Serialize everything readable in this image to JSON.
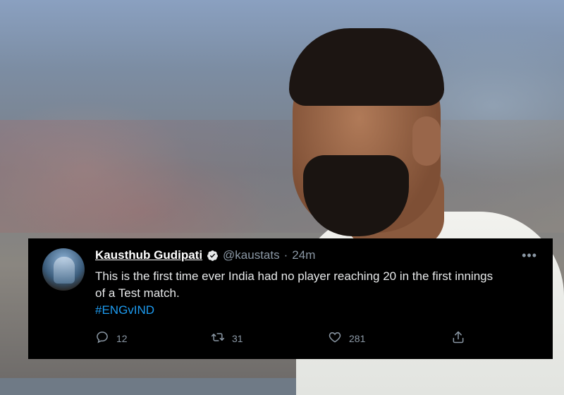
{
  "tweet": {
    "author_name": "Kausthub Gudipati",
    "handle": "@kaustats",
    "separator": "·",
    "time": "24m",
    "more_label": "•••",
    "text_line1": "This is the first time ever India had no player reaching 20 in the first innings",
    "text_line2": "of a Test match.",
    "hashtag": "#ENGvIND",
    "replies": "12",
    "retweets": "31",
    "likes": "281"
  },
  "colors": {
    "card_bg": "#000000",
    "text": "#e7e9ea",
    "muted": "#8b98a5",
    "link": "#1d9bf0",
    "verified": "#ffffff"
  },
  "icons": {
    "reply": "reply-icon",
    "retweet": "retweet-icon",
    "like": "heart-icon",
    "share": "share-icon",
    "verified": "verified-badge-icon",
    "more": "more-options-icon"
  }
}
